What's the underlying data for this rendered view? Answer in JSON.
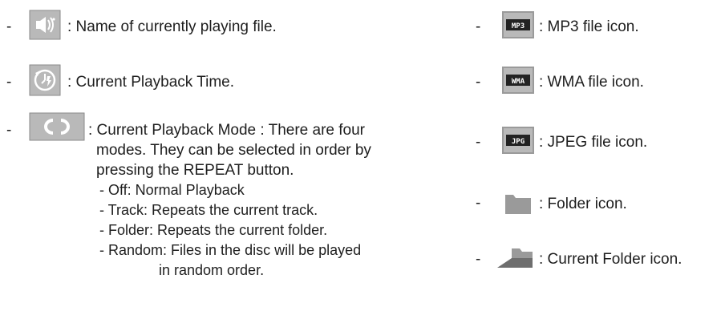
{
  "bullet": "-",
  "left": {
    "items": [
      {
        "icon": "speaker-icon",
        "text": ":  Name of currently playing file."
      },
      {
        "icon": "playback-time-icon",
        "text": ":  Current Playback Time."
      }
    ],
    "mode": {
      "icon": "repeat-icon",
      "lines": [
        ": Current Playback Mode : There are four",
        "modes. They can be selected in order by",
        "pressing the REPEAT button."
      ],
      "options": [
        "- Off: Normal Playback",
        "- Track: Repeats the current track.",
        "- Folder: Repeats the current folder.",
        "- Random: Files in the disc will be played"
      ],
      "continuation": "in random order."
    }
  },
  "right": {
    "items": [
      {
        "icon": "mp3-file-icon",
        "badge": "MP3",
        "text": ": MP3 file icon."
      },
      {
        "icon": "wma-file-icon",
        "badge": "WMA",
        "text": ": WMA file icon."
      },
      {
        "icon": "jpeg-file-icon",
        "badge": "JPG",
        "text": ": JPEG file icon."
      },
      {
        "icon": "folder-icon",
        "text": ": Folder icon."
      },
      {
        "icon": "current-folder-icon",
        "text": ": Current Folder icon."
      }
    ]
  }
}
